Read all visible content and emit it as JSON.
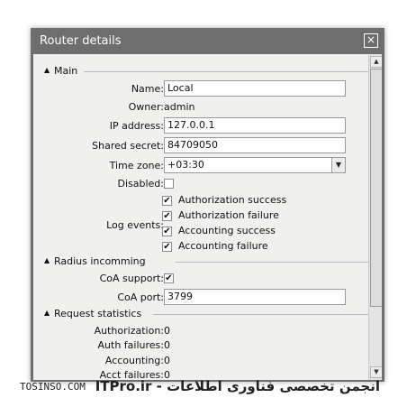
{
  "dialog": {
    "title": "Router details",
    "close_icon": "×"
  },
  "sections": {
    "main": "Main",
    "radius": "Radius incomming",
    "stats": "Request statistics"
  },
  "fields": {
    "name_label": "Name:",
    "name_value": "Local",
    "owner_label": "Owner:",
    "owner_value": "admin",
    "ip_label": "IP address:",
    "ip_value": "127.0.0.1",
    "secret_label": "Shared secret:",
    "secret_value": "84709050",
    "timezone_label": "Time zone:",
    "timezone_value": "+03:30",
    "disabled_label": "Disabled:",
    "log_label": "Log events:",
    "log_items": [
      {
        "label": "Authorization success",
        "checked": true
      },
      {
        "label": "Authorization failure",
        "checked": true
      },
      {
        "label": "Accounting success",
        "checked": true
      },
      {
        "label": "Accounting failure",
        "checked": true
      }
    ],
    "coa_support_label": "CoA support:",
    "coa_port_label": "CoA port:",
    "coa_port_value": "3799"
  },
  "stats": [
    {
      "label": "Authorization:",
      "value": "0"
    },
    {
      "label": "Auth failures:",
      "value": "0"
    },
    {
      "label": "Accounting:",
      "value": "0"
    },
    {
      "label": "Acct failures:",
      "value": "0"
    }
  ],
  "checkmark": "✔",
  "watermark": {
    "left": "TOSINSO.COM",
    "right": "ITPro.ir - انجمن تخصصی فناوری اطلاعات"
  }
}
